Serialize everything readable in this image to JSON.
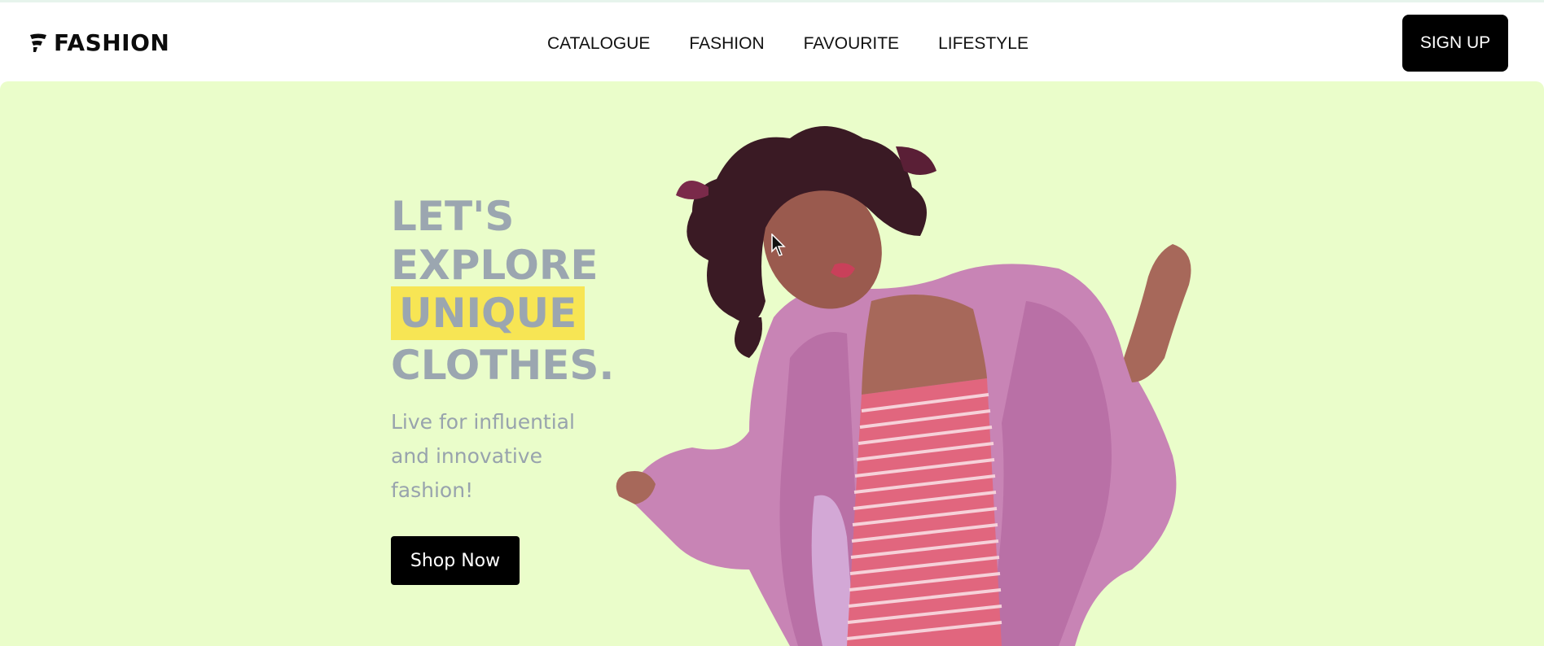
{
  "brand": {
    "name": "FASHION",
    "icon": "fashion-logo-icon"
  },
  "nav": {
    "items": [
      {
        "label": "CATALOGUE"
      },
      {
        "label": "FASHION"
      },
      {
        "label": "FAVOURITE"
      },
      {
        "label": "LIFESTYLE"
      }
    ],
    "signup_label": "SIGN UP"
  },
  "hero": {
    "headline": {
      "line1": "LET'S",
      "line2": "EXPLORE",
      "highlight": "UNIQUE",
      "line4": "CLOTHES."
    },
    "subtitle": "Live for influential and innovative fashion!",
    "cta_label": "Shop Now",
    "image": "woman-in-pink-fur-coat-dancing"
  },
  "colors": {
    "hero_bg": "#eafdca",
    "highlight": "#f7e554",
    "headline": "#9ba6b0",
    "button_bg": "#000000"
  }
}
